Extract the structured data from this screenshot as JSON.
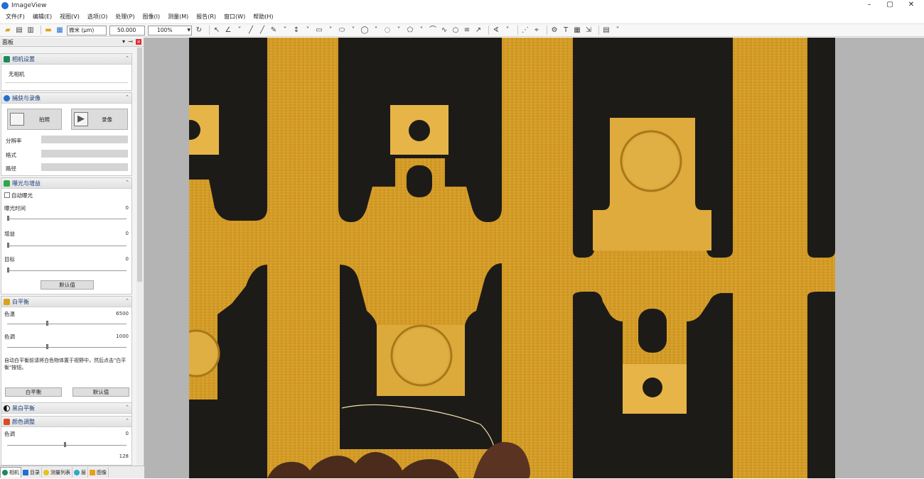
{
  "window": {
    "title": "ImageView",
    "minimize": "–",
    "maximize": "▢",
    "close": "✕"
  },
  "menu": [
    "文件(F)",
    "编辑(E)",
    "视图(V)",
    "选项(O)",
    "处理(P)",
    "图像(I)",
    "测量(M)",
    "报告(R)",
    "窗口(W)",
    "帮助(H)"
  ],
  "toolbar": {
    "unit": "微米 (μm)",
    "magnification": "50.000",
    "zoom": "100%"
  },
  "sidebar": {
    "title": "面板",
    "camera_panel": {
      "title": "相机设置",
      "camera_name": "无相机"
    },
    "capture_panel": {
      "title": "捕获与录像",
      "snap_label": "拍照",
      "record_label": "录像",
      "fields": [
        "分辨率",
        "格式",
        "路径"
      ]
    },
    "exposure_panel": {
      "title": "曝光与增益",
      "auto_label": "自动曝光",
      "slider1_label": "曝光时间",
      "slider1_value": "0",
      "slider2_label": "增益",
      "slider2_value": "0",
      "slider3_label": "目标",
      "slider3_value": "0",
      "default_button": "默认值"
    },
    "wb_panel": {
      "title": "白平衡",
      "slider1_label": "色温",
      "slider1_value": "6500",
      "slider2_label": "色调",
      "slider2_value": "1000",
      "hint_text": "自动白平衡前请将白色物体置于视野中，然后点击\"白平衡\"按钮。",
      "btn_left": "白平衡",
      "btn_right": "默认值"
    },
    "bw_panel": {
      "title": "黑白平衡"
    },
    "color_panel": {
      "title": "颜色调整",
      "slider1_label": "色调",
      "slider1_value": "0",
      "slider2_value": "128"
    }
  },
  "bottom_tabs": [
    "相机",
    "目录",
    "测量列表",
    "层",
    "图像"
  ],
  "colors": {
    "accent": "#1a3f7a",
    "gold": "#d4a02c",
    "dark": "#1c1a15",
    "canvas_bg": "#b4b4b4"
  },
  "icons": [
    "folder-open-icon",
    "save-icon",
    "print-icon",
    "grid-icon",
    "rotate-icon",
    "pointer-icon",
    "line-icon",
    "rect-icon",
    "ellipse-icon",
    "arrow-icon",
    "text-icon"
  ]
}
